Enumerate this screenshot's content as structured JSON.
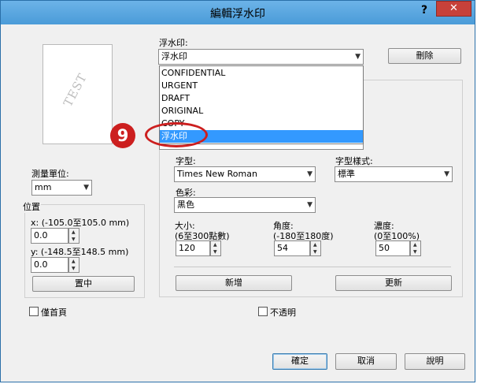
{
  "window": {
    "title": "編輯浮水印",
    "help": "?",
    "close": "✕"
  },
  "preview": {
    "watermark_text": "TEST"
  },
  "watermark": {
    "label": "浮水印:",
    "selected": "浮水印",
    "delete_button": "刪除",
    "options": [
      "CONFIDENTIAL",
      "URGENT",
      "DRAFT",
      "ORIGINAL",
      "COPY",
      "浮水印"
    ]
  },
  "callout": {
    "step": "9"
  },
  "units": {
    "label": "測量單位:",
    "value": "mm"
  },
  "position": {
    "title": "位置",
    "x_label": "x: (-105.0至105.0 mm)",
    "x_value": "0.0",
    "y_label": "y: (-148.5至148.5 mm)",
    "y_value": "0.0",
    "center_button": "置中"
  },
  "font": {
    "label": "字型:",
    "value": "Times New Roman"
  },
  "style": {
    "label": "字型樣式:",
    "value": "標準"
  },
  "color": {
    "label": "色彩:",
    "value": "黑色"
  },
  "size": {
    "label1": "大小:",
    "label2": "(6至300點數)",
    "value": "120"
  },
  "angle": {
    "label1": "角度:",
    "label2": "(-180至180度)",
    "value": "54"
  },
  "density": {
    "label1": "濃度:",
    "label2": "(0至100%)",
    "value": "50"
  },
  "buttons": {
    "add": "新增",
    "update": "更新",
    "ok": "確定",
    "cancel": "取消",
    "help": "說明"
  },
  "options": {
    "first_page_only": "僅首頁",
    "opaque": "不透明"
  },
  "colors": {
    "accent": "#3399ff",
    "callout": "#cc1f1f",
    "titlebar": "#6cb3e8"
  }
}
